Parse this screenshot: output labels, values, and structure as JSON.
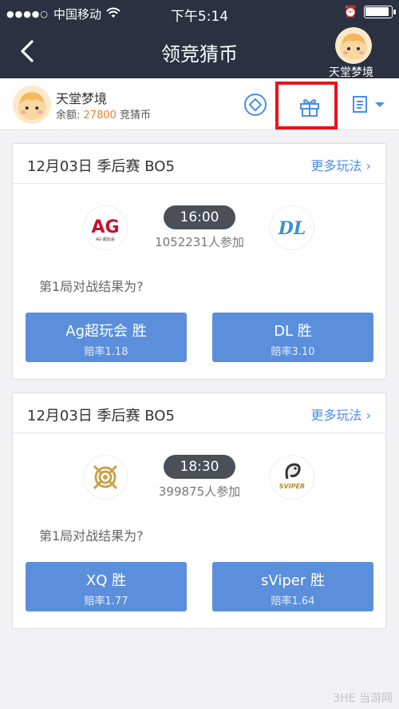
{
  "status_bar": {
    "carrier": "中国移动",
    "time": "下午5:14"
  },
  "nav": {
    "title": "领竞猜币",
    "user_name": "天堂梦境"
  },
  "user": {
    "name": "天堂梦境",
    "balance_label": "余额:",
    "balance_value": "27800",
    "balance_unit": "竞猜币"
  },
  "highlight_color": "#e8131c",
  "matches": [
    {
      "date": "12月03日  季后赛  BO5",
      "more": "更多玩法 ›",
      "time": "16:00",
      "participants": "1052231人参加",
      "question": "第1局对战结果为?",
      "team_left": {
        "logo_text": "AG",
        "logo_sub": "AG·超玩会"
      },
      "team_right": {
        "logo_text": "DL"
      },
      "options": [
        {
          "label": "Ag超玩会 胜",
          "odds": "赔率1.18"
        },
        {
          "label": "DL 胜",
          "odds": "赔率3.10"
        }
      ]
    },
    {
      "date": "12月03日  季后赛  BO5",
      "more": "更多玩法 ›",
      "time": "18:30",
      "participants": "399875人参加",
      "question": "第1局对战结果为?",
      "team_left": {
        "logo_text": ""
      },
      "team_right": {
        "logo_text": "SVIPER"
      },
      "options": [
        {
          "label": "XQ 胜",
          "odds": "赔率1.77"
        },
        {
          "label": "sViper 胜",
          "odds": "赔率1.64"
        }
      ]
    }
  ],
  "watermark": "3HE 当游网"
}
